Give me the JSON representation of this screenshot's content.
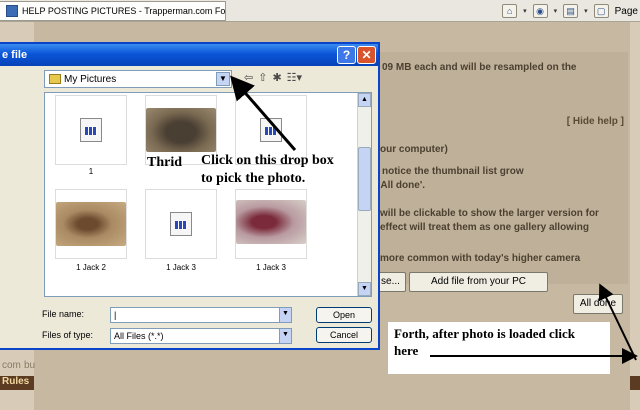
{
  "browser": {
    "tab_title": "HELP POSTING PICTURES - Trapperman.com Forums",
    "page_label": "Page"
  },
  "forum": {
    "help_lines": [
      "09 MB each and will be resampled on the",
      "our computer)",
      "notice the thumbnail list grow",
      "'All done'.",
      "will be clickable to show the larger version for",
      "effect will treat them as one gallery allowing",
      "more common with today's higher camera"
    ],
    "hide_help": "[ Hide help ]",
    "partial_button": "se...",
    "add_file_button": "Add file from your PC",
    "all_done_button": "All done",
    "left_text_1": "com",
    "left_text_2": "bu",
    "rules_link": "Rules"
  },
  "dialog": {
    "title": "e file",
    "help_btn": "?",
    "close_btn": "✕",
    "look_in_value": "My Pictures",
    "files": [
      {
        "label": "1",
        "type": "doc"
      },
      {
        "label": "",
        "type": "photo",
        "color": "#7a6a52"
      },
      {
        "label": "",
        "type": "doc"
      },
      {
        "label": "1 Jack 2",
        "type": "photo",
        "color": "#a98a63"
      },
      {
        "label": "1 Jack 3",
        "type": "doc"
      },
      {
        "label": "1 Jack 3",
        "type": "photo",
        "color": "#b89aa0"
      }
    ],
    "file_name_label": "File name:",
    "file_name_value": "|",
    "file_type_label": "Files of type:",
    "file_type_value": "All Files (*.*)",
    "open_btn": "Open",
    "cancel_btn": "Cancel"
  },
  "annotations": {
    "third": "Thrid",
    "dropbox_line1": "Click on this drop box",
    "dropbox_line2": "to pick the photo.",
    "forth_line1": "Forth, after photo is loaded click",
    "forth_line2": "here"
  }
}
